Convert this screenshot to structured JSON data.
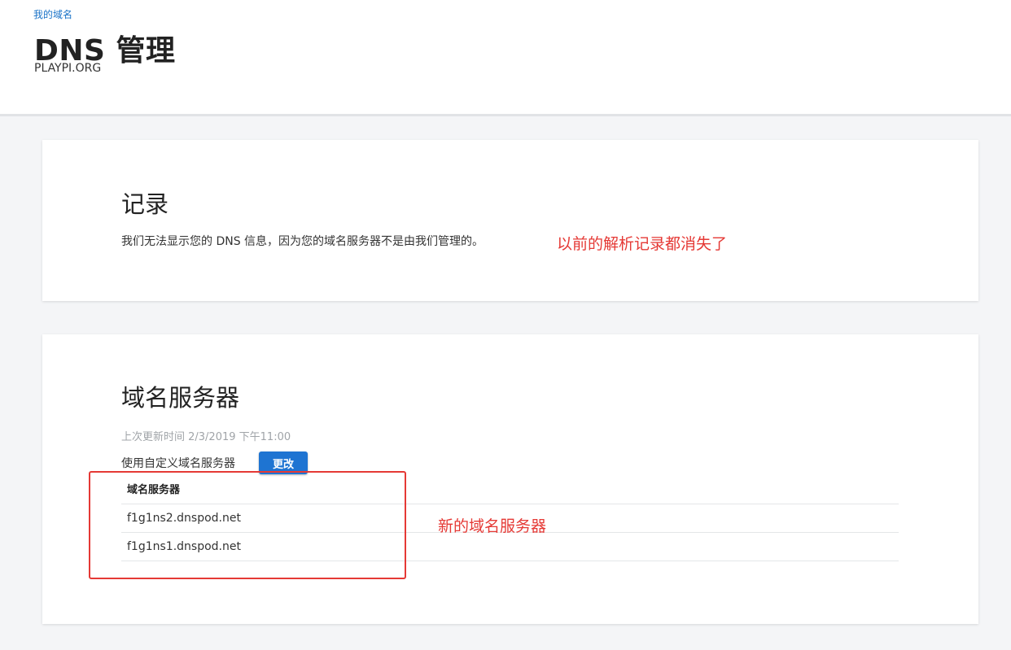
{
  "header": {
    "breadcrumb": "我的域名",
    "title": "DNS 管理",
    "domain": "PLAYPI.ORG"
  },
  "records": {
    "title": "记录",
    "message": "我们无法显示您的 DNS 信息，因为您的域名服务器不是由我们管理的。",
    "annotation": "以前的解析记录都消失了"
  },
  "nameservers": {
    "title": "域名服务器",
    "last_updated": "上次更新时间 2/3/2019 下午11:00",
    "mode_label": "使用自定义域名服务器",
    "change_label": "更改",
    "table_header": "域名服务器",
    "rows": [
      "f1g1ns2.dnspod.net",
      "f1g1ns1.dnspod.net"
    ],
    "annotation": "新的域名服务器"
  },
  "colors": {
    "accent": "#1e74d2",
    "annotation": "#e53935"
  }
}
